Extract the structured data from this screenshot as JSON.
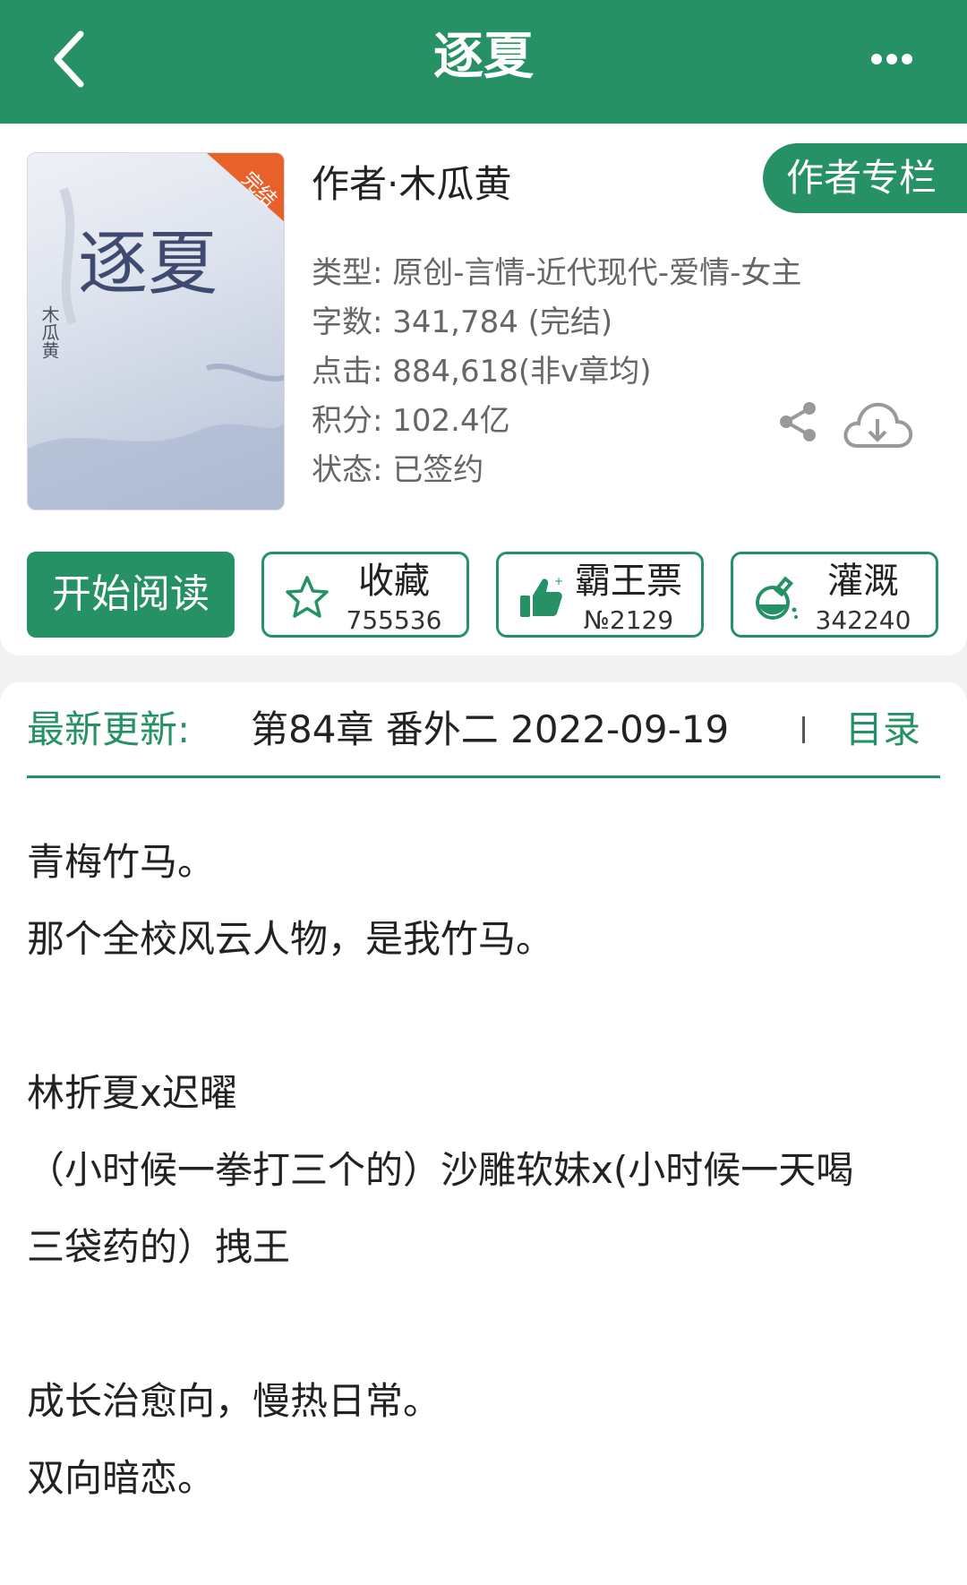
{
  "header": {
    "title": "逐夏",
    "back_icon": "back-arrow-icon",
    "more_icon": "more-dots-icon"
  },
  "book": {
    "cover_badge": "完结",
    "cover_title": "逐夏",
    "cover_author": "木瓜黄",
    "author_line": "作者·木瓜黄",
    "author_column_label": "作者专栏",
    "meta": [
      "类型: 原创-言情-近代现代-爱情-女主",
      "字数: 341,784 (完结)",
      "点击: 884,618(非v章均)",
      "积分: 102.4亿",
      "状态: 已签约"
    ]
  },
  "actions": {
    "read_label": "开始阅读",
    "favorite": {
      "label": "收藏",
      "count": "755536",
      "icon": "star-icon"
    },
    "vote": {
      "label": "霸王票",
      "count": "№2129",
      "icon": "thumbs-up-icon"
    },
    "nutrient": {
      "label": "灌溉",
      "count": "342240",
      "icon": "flask-icon"
    }
  },
  "update": {
    "label": "最新更新:",
    "chapter": "第84章  番外二  2022-09-19",
    "toc_label": "目录"
  },
  "description": [
    "青梅竹马。",
    "那个全校风云人物，是我竹马。",
    "",
    "林折夏x迟曜",
    "（小时候一拳打三个的）沙雕软妹x(小时候一天喝",
    "三袋药的）拽王",
    "",
    "成长治愈向，慢热日常。",
    "双向暗恋。"
  ],
  "colors": {
    "brand_green": "#259164",
    "badge_orange": "#e8602a"
  }
}
